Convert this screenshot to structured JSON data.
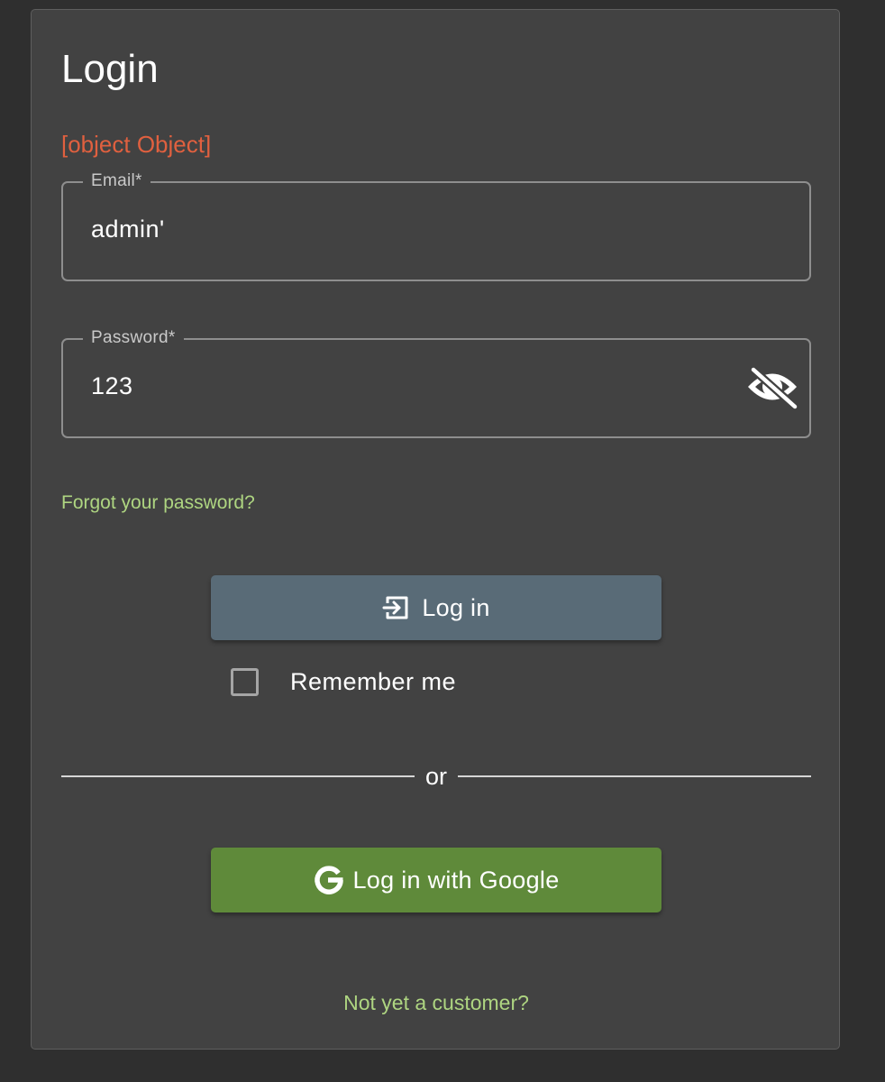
{
  "login": {
    "title": "Login",
    "error_message": "[object Object]",
    "email": {
      "label": "Email*",
      "value": "admin'"
    },
    "password": {
      "label": "Password*",
      "value": "123",
      "toggle_icon": "eye-off-icon"
    },
    "forgot_password": "Forgot your password?",
    "login_button": {
      "label": "Log in",
      "icon": "login-icon"
    },
    "remember_me": {
      "label": "Remember me",
      "checked": false
    },
    "divider_text": "or",
    "google_button": {
      "label": "Log in with Google",
      "icon": "google-icon"
    },
    "signup_link": "Not yet a customer?"
  },
  "colors": {
    "page_background": "#2f2f2f",
    "card_background": "#424242",
    "error": "#e0603f",
    "link": "#aed581",
    "login_button": "#596b77",
    "google_button": "#5f8a3a"
  }
}
